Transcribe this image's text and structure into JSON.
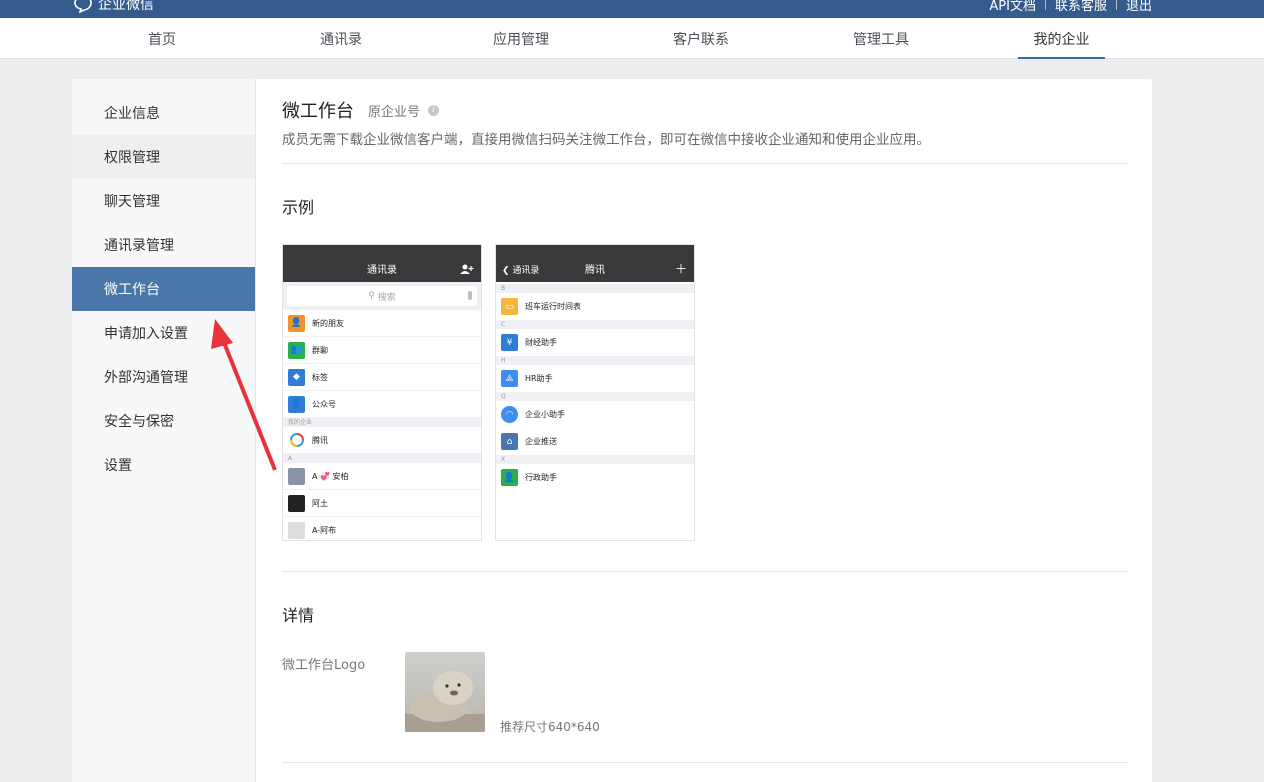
{
  "topbar": {
    "brand": "企业微信",
    "links": [
      "API文档",
      "联系客服",
      "退出"
    ]
  },
  "nav": {
    "items": [
      "首页",
      "通讯录",
      "应用管理",
      "客户联系",
      "管理工具",
      "我的企业"
    ],
    "active": "我的企业"
  },
  "sidebar": {
    "items": [
      "企业信息",
      "权限管理",
      "聊天管理",
      "通讯录管理",
      "微工作台",
      "申请加入设置",
      "外部沟通管理",
      "安全与保密",
      "设置"
    ],
    "active": "微工作台"
  },
  "main": {
    "title": "微工作台",
    "subtitle": "原企业号",
    "description": "成员无需下载企业微信客户端，直接用微信扫码关注微工作台，即可在微信中接收企业通知和使用企业应用。",
    "example_title": "示例",
    "details_title": "详情",
    "logo_label": "微工作台Logo",
    "logo_hint": "推荐尺寸640*640"
  },
  "phone1": {
    "title": "通讯录",
    "search_placeholder": "搜索",
    "rows": [
      "新的朋友",
      "群聊",
      "标签",
      "公众号"
    ],
    "section_my_company": "我的企业",
    "company": "腾讯",
    "section_a": "A",
    "contacts": [
      "A 💞 安柏",
      "阿土",
      "A-阿布"
    ]
  },
  "phone2": {
    "back": "通讯录",
    "title": "腾讯",
    "sections": [
      {
        "letter": "B",
        "items": [
          "班车运行时间表"
        ]
      },
      {
        "letter": "C",
        "items": [
          "财经助手"
        ]
      },
      {
        "letter": "H",
        "items": [
          "HR助手"
        ]
      },
      {
        "letter": "Q",
        "items": [
          "企业小助手",
          "企业推送"
        ]
      },
      {
        "letter": "X",
        "items": [
          "行政助手"
        ]
      }
    ]
  },
  "colors": {
    "topbar": "#355b8c",
    "active_sidebar": "#4a77aa",
    "nav_underline": "#3a6aa8",
    "arrow": "#e8323c"
  }
}
